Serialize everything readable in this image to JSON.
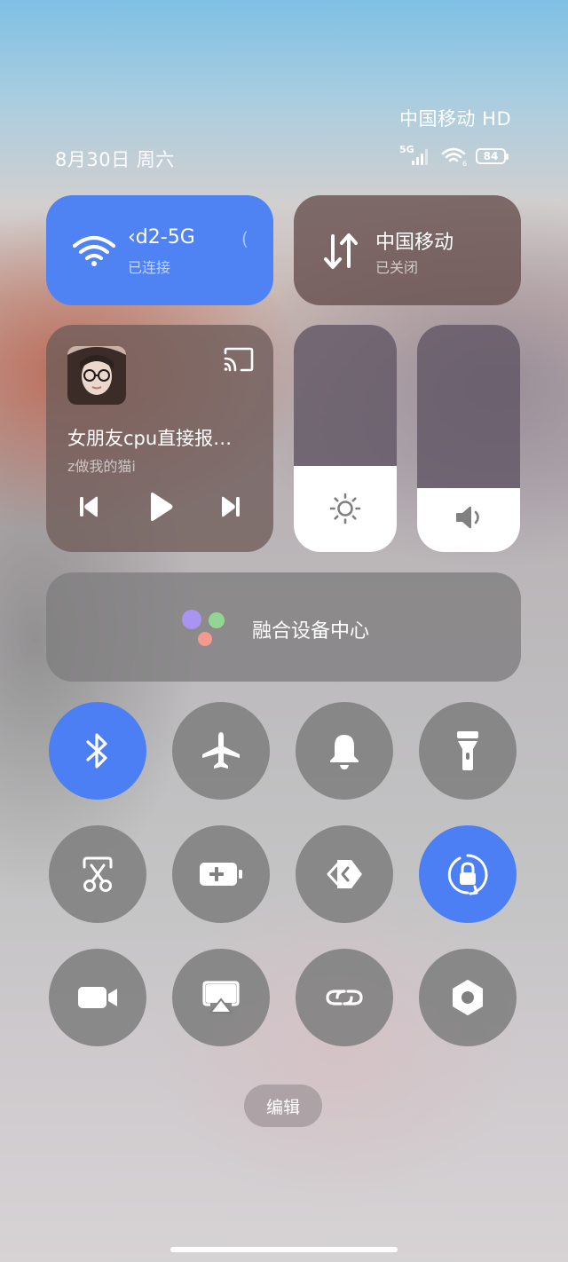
{
  "status_bar": {
    "carrier_label": "中国移动 HD",
    "date_text": "8月30日 周六",
    "network_type": "5G",
    "battery_level": "84",
    "icons": [
      "5g-signal-icon",
      "wifi-signal-icon",
      "battery-icon"
    ]
  },
  "wifi_tile": {
    "network_name": "‹d2-5G",
    "status": "已连接",
    "icon": "wifi-icon",
    "accent_color": "#4f83f4"
  },
  "cellular_tile": {
    "carrier": "中国移动",
    "status": "已关闭",
    "icon": "data-transfer-icon"
  },
  "media_player": {
    "song_title": "女朋友cpu直接报…",
    "artist": "z做我的猫i",
    "icons": [
      "cast-icon",
      "previous-icon",
      "play-icon",
      "next-icon"
    ]
  },
  "sliders": {
    "brightness_level": 0.38,
    "volume_level": 0.28,
    "icons": [
      "brightness-icon",
      "volume-icon"
    ]
  },
  "device_center": {
    "label": "融合设备中心",
    "icon": "device-center-icon"
  },
  "toggles": [
    {
      "name": "bluetooth",
      "icon": "bluetooth-icon",
      "active": true
    },
    {
      "name": "airplane-mode",
      "icon": "airplane-icon",
      "active": false
    },
    {
      "name": "ringer",
      "icon": "bell-icon",
      "active": false
    },
    {
      "name": "flashlight",
      "icon": "flashlight-icon",
      "active": false
    },
    {
      "name": "screenshot",
      "icon": "screenshot-scissors-icon",
      "active": false
    },
    {
      "name": "battery-saver",
      "icon": "battery-plus-icon",
      "active": false
    },
    {
      "name": "nfc-share",
      "icon": "share-arrow-icon",
      "active": false
    },
    {
      "name": "rotation-lock",
      "icon": "rotation-lock-icon",
      "active": true
    },
    {
      "name": "screen-record",
      "icon": "video-camera-icon",
      "active": false
    },
    {
      "name": "screen-cast",
      "icon": "cast-screen-icon",
      "active": false
    },
    {
      "name": "link",
      "icon": "link-icon",
      "active": false
    },
    {
      "name": "settings",
      "icon": "hexagon-settings-icon",
      "active": false
    }
  ],
  "edit_button": {
    "label": "编辑"
  }
}
